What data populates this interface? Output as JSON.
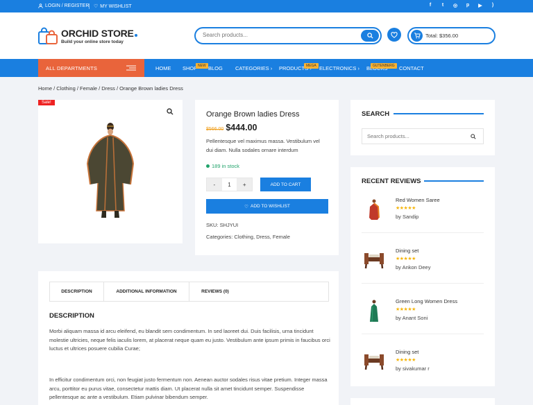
{
  "topbar": {
    "login": "LOGIN / REGISTER",
    "wishlist": "MY WISHLIST",
    "social": [
      "facebook-icon",
      "twitter-icon",
      "instagram-icon",
      "pinterest-icon",
      "youtube-icon",
      "rss-icon"
    ]
  },
  "header": {
    "logo_title": "ORCHID STORE",
    "logo_sub": "Build your online store today",
    "search_placeholder": "Search products...",
    "cart_total": "Total: $356.00"
  },
  "nav": {
    "departments": "ALL DEPARTMENTS",
    "items": [
      {
        "label": "HOME"
      },
      {
        "label": "SHOP",
        "badge": "NEW"
      },
      {
        "label": "BLOG"
      },
      {
        "label": "CATEGORIES"
      },
      {
        "label": "PRODUCTS",
        "badge": "MEGA"
      },
      {
        "label": "ELECTRONICS"
      },
      {
        "label": "BLOCKS",
        "badge": "GUTENBERG"
      },
      {
        "label": "CONTACT"
      }
    ]
  },
  "breadcrumb": "Home / Clothing / Female / Dress / Orange Brown ladies Dress",
  "product": {
    "sale_badge": "Sale!",
    "title": "Orange Brown ladies Dress",
    "old_price": "$566.00",
    "price": "$444.00",
    "description": "Pellentesque vel maximus massa. Vestibulum vel dui diam. Nulla sodales ornare interdum",
    "stock": "189 in stock",
    "qty_minus": "-",
    "qty": "1",
    "qty_plus": "+",
    "add_to_cart": "ADD TO CART",
    "add_to_wishlist": "ADD TO WISHLIST",
    "sku": "SKU: SHJYUI",
    "categories": "Categories: Clothing, Dress, Female"
  },
  "tabs": [
    "DESCRIPTION",
    "ADDITIONAL INFORMATION",
    "REVIEWS (0)"
  ],
  "description": {
    "heading": "DESCRIPTION",
    "p1": "Morbi aliquam massa id arcu eleifend, eu blandit sem condimentum. In sed laoreet dui. Duis facilisis, urna tincidunt molestie ultricies, neque felis iaculis lorem, at placerat neque quam eu justo. Vestibulum ante ipsum primis in faucibus orci luctus et ultrices posuere cubilia Curae;",
    "p2": "In efficitur condimentum orci, non feugiat justo fermentum non. Aenean auctor sodales risus vitae pretium. Integer massa arcu, porttitor eu purus vitae, consectetur mattis diam. Ut placerat nulla sit amet tincidunt semper. Suspendisse pellentesque ac ante a vestibulum. Etiam pulvinar bibendum semper."
  },
  "sidebar": {
    "search_title": "SEARCH",
    "search_placeholder": "Search products...",
    "reviews_title": "RECENT REVIEWS",
    "reviews": [
      {
        "title": "Red Women Saree",
        "stars": "★★★★★",
        "by": "by Sandip"
      },
      {
        "title": "Dining set",
        "stars": "★★★★★",
        "by": "by Ankon Deey"
      },
      {
        "title": "Green Long Women Dress",
        "stars": "★★★★★",
        "by": "by Anant Soni"
      },
      {
        "title": "Dining set",
        "stars": "★★★★★",
        "by": "by sivakumar r"
      }
    ]
  },
  "colors": {
    "primary": "#1a7fe0",
    "departments": "#e9643b",
    "badge": "#f9b233",
    "sale": "#e22222",
    "stars": "#f5b50a",
    "stock": "#21a36b"
  }
}
